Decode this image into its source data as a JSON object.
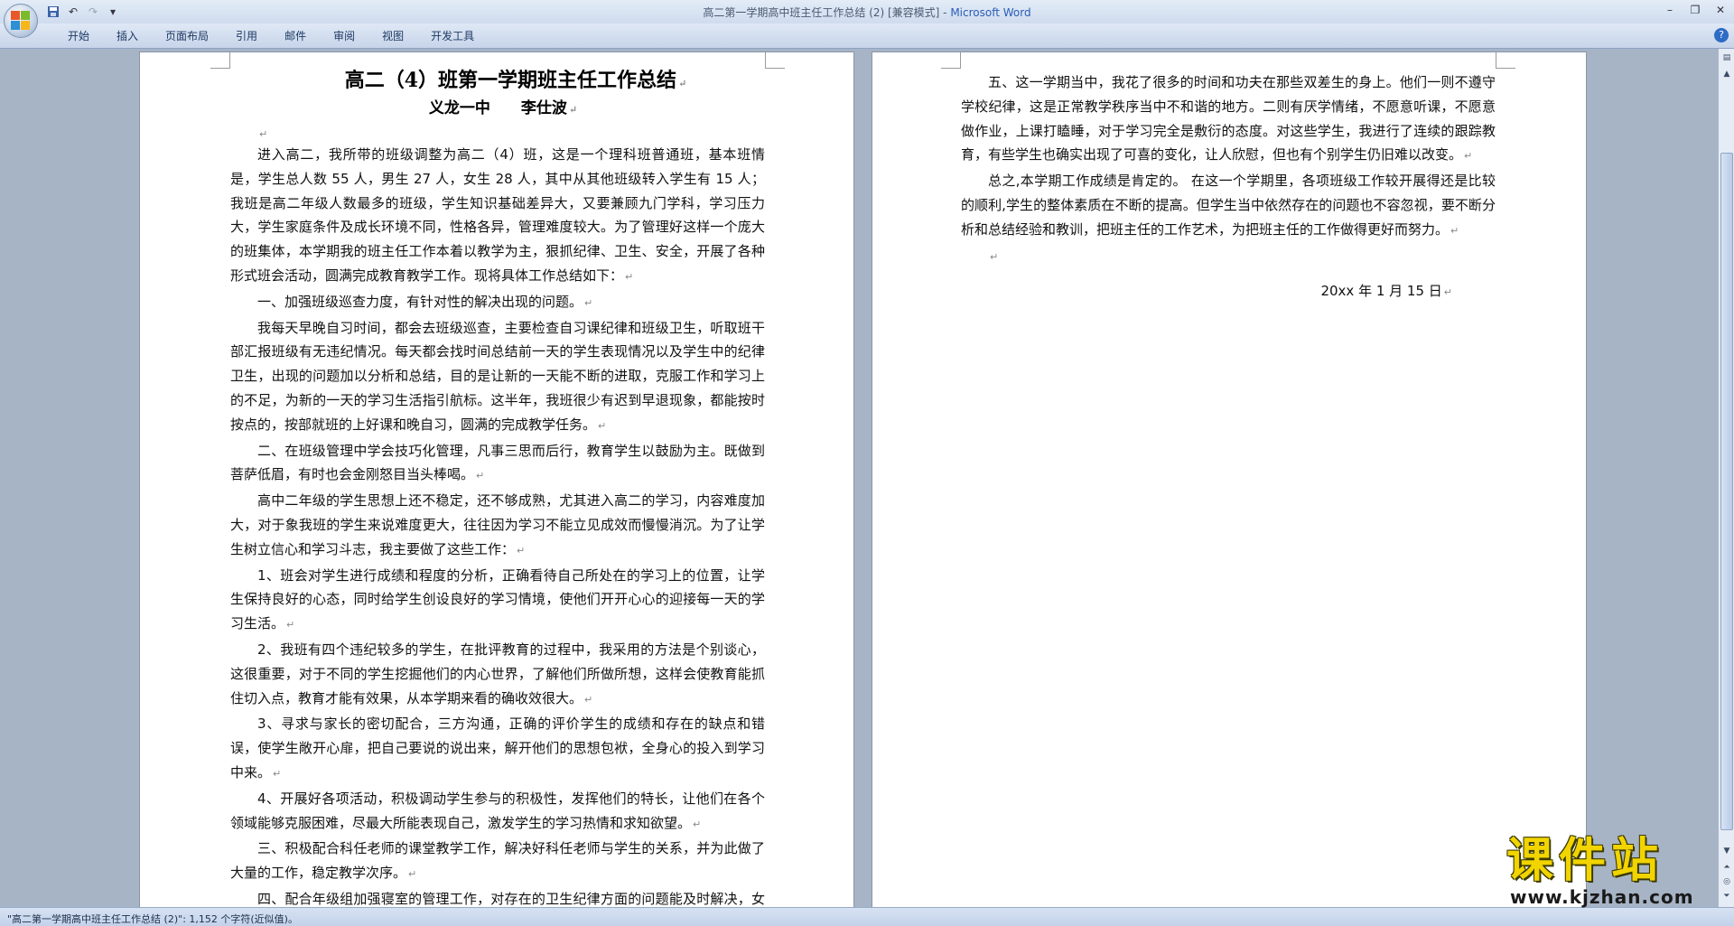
{
  "window": {
    "title_doc": "高二第一学期高中班主任工作总结 (2) [兼容模式] - ",
    "title_app": "Microsoft Word",
    "help": "?"
  },
  "qat": {
    "save_icon": "save-icon",
    "undo_icon": "undo-icon",
    "redo_icon": "redo-icon",
    "more": "▾"
  },
  "ribbon": {
    "tabs": [
      "开始",
      "插入",
      "页面布局",
      "引用",
      "邮件",
      "审阅",
      "视图",
      "开发工具"
    ]
  },
  "document": {
    "title": "高二（4）班第一学期班主任工作总结",
    "author": "义龙一中 李仕波",
    "left_paragraphs": [
      "进入高二，我所带的班级调整为高二（4）班，这是一个理科班普通班，基本班情是，学生总人数 55 人，男生 27 人，女生 28 人，其中从其他班级转入学生有 15 人；我班是高二年级人数最多的班级，学生知识基础差异大，又要兼顾九门学科，学习压力大，学生家庭条件及成长环境不同，性格各异，管理难度较大。为了管理好这样一个庞大的班集体，本学期我的班主任工作本着以教学为主，狠抓纪律、卫生、安全，开展了各种形式班会活动，圆满完成教育教学工作。现将具体工作总结如下：",
      "一、加强班级巡查力度，有针对性的解决出现的问题。",
      "我每天早晚自习时间，都会去班级巡查，主要检查自习课纪律和班级卫生，听取班干部汇报班级有无违纪情况。每天都会找时间总结前一天的学生表现情况以及学生中的纪律卫生，出现的问题加以分析和总结，目的是让新的一天能不断的进取，克服工作和学习上的不足，为新的一天的学习生活指引航标。这半年，我班很少有迟到早退现象，都能按时按点的，按部就班的上好课和晚自习，圆满的完成教学任务。",
      "二、在班级管理中学会技巧化管理，凡事三思而后行，教育学生以鼓励为主。既做到菩萨低眉，有时也会金刚怒目当头棒喝。",
      "高中二年级的学生思想上还不稳定，还不够成熟，尤其进入高二的学习，内容难度加大，对于象我班的学生来说难度更大，往往因为学习不能立见成效而慢慢消沉。为了让学生树立信心和学习斗志，我主要做了这些工作：",
      "1、班会对学生进行成绩和程度的分析，正确看待自己所处在的学习上的位置，让学生保持良好的心态，同时给学生创设良好的学习情境，使他们开开心心的迎接每一天的学习生活。",
      "2、我班有四个违纪较多的学生，在批评教育的过程中，我采用的方法是个别谈心，这很重要，对于不同的学生挖掘他们的内心世界，了解他们所做所想，这样会使教育能抓住切入点，教育才能有效果，从本学期来看的确收效很大。",
      "3、寻求与家长的密切配合，三方沟通，正确的评价学生的成绩和存在的缺点和错误，使学生敞开心扉，把自己要说的说出来，解开他们的思想包袱，全身心的投入到学习中来。",
      "4、开展好各项活动，积极调动学生参与的积极性，发挥他们的特长，让他们在各个领域能够克服困难，尽最大所能表现自己，激发学生的学习热情和求知欲望。",
      "三、积极配合科任老师的课堂教学工作，解决好科任老师与学生的关系，并为此做了大量的工作，稳定教学次序。",
      "四、配合年级组加强寝室的管理工作，对存在的卫生纪律方面的问题能及时解决，女寝要好一些，男寝还存在问题，总的来说有很大的进步。"
    ],
    "right_paragraphs": [
      "五、这一学期当中，我花了很多的时间和功夫在那些双差生的身上。他们一则不遵守学校纪律，这是正常教学秩序当中不和谐的地方。二则有厌学情绪，不愿意听课，不愿意做作业，上课打瞌睡，对于学习完全是敷衍的态度。对这些学生，我进行了连续的跟踪教育，有些学生也确实出现了可喜的变化，让人欣慰，但也有个别学生仍旧难以改变。",
      "总之,本学期工作成绩是肯定的。 在这一个学期里，各项班级工作较开展得还是比较的顺利,学生的整体素质在不断的提高。但学生当中依然存在的问题也不容忽视，要不断分析和总结经验和教训，把班主任的工作艺术，为把班主任的工作做得更好而努力。"
    ],
    "date": "20xx 年 1 月 15 日",
    "para_mark": "↵"
  },
  "status": {
    "text": "\"高二第一学期高中班主任工作总结 (2)\": 1,152 个字符(近似值)。"
  },
  "watermark": {
    "text": "课件站",
    "url": "www.kjzhan.com"
  },
  "scrollbar": {
    "up": "▲",
    "down": "▼",
    "prev_page": "◎",
    "next_page": "▼"
  }
}
